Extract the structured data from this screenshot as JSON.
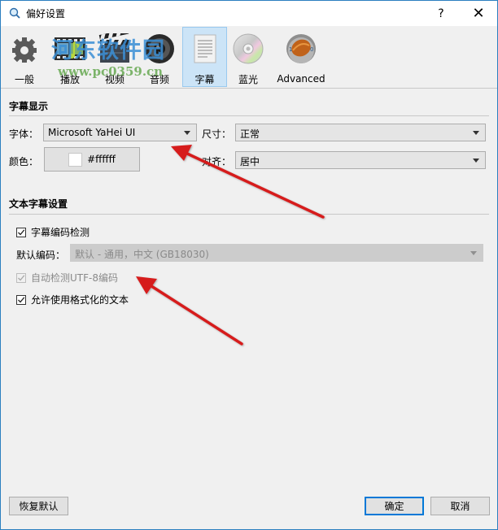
{
  "window": {
    "title": "偏好设置",
    "help_label": "?",
    "close_label": "✕",
    "border_color": "#2b7fc0"
  },
  "watermark": {
    "text": "河东软件园",
    "url": "www.pc0359.cn"
  },
  "toolbar": {
    "items": [
      {
        "label": "一般",
        "icon": "gear-icon",
        "active": false
      },
      {
        "label": "播放",
        "icon": "film-music-icon",
        "active": false
      },
      {
        "label": "视频",
        "icon": "clapperboard-icon",
        "active": false
      },
      {
        "label": "音频",
        "icon": "speaker-icon",
        "active": false
      },
      {
        "label": "字幕",
        "icon": "document-lines-icon",
        "active": true
      },
      {
        "label": "蓝光",
        "icon": "disc-icon",
        "active": false
      },
      {
        "label": "Advanced",
        "icon": "advanced-orb-icon",
        "active": false
      }
    ],
    "active_color": "#cce4f7"
  },
  "subtitle_display": {
    "section_title": "字幕显示",
    "font_label": "字体：",
    "font_value": "Microsoft YaHei UI",
    "size_label": "尺寸：",
    "size_value": "正常",
    "color_label": "颜色：",
    "color_value": "#ffffff",
    "align_label": "对齐：",
    "align_value": "居中"
  },
  "text_subtitle": {
    "section_title": "文本字幕设置",
    "encoding_detect": {
      "label": "字幕编码检测",
      "checked": true,
      "enabled": true
    },
    "default_encoding_label": "默认编码：",
    "default_encoding_value": "默认 - 通用，中文 (GB18030)",
    "auto_utf8": {
      "label": "自动检测UTF-8编码",
      "checked": true,
      "enabled": false
    },
    "allow_formatted": {
      "label": "允许使用格式化的文本",
      "checked": true,
      "enabled": true
    }
  },
  "footer": {
    "restore_label": "恢复默认",
    "ok_label": "确定",
    "cancel_label": "取消"
  },
  "annotations": {
    "arrow_color": "#d61a1a",
    "count": 2
  }
}
